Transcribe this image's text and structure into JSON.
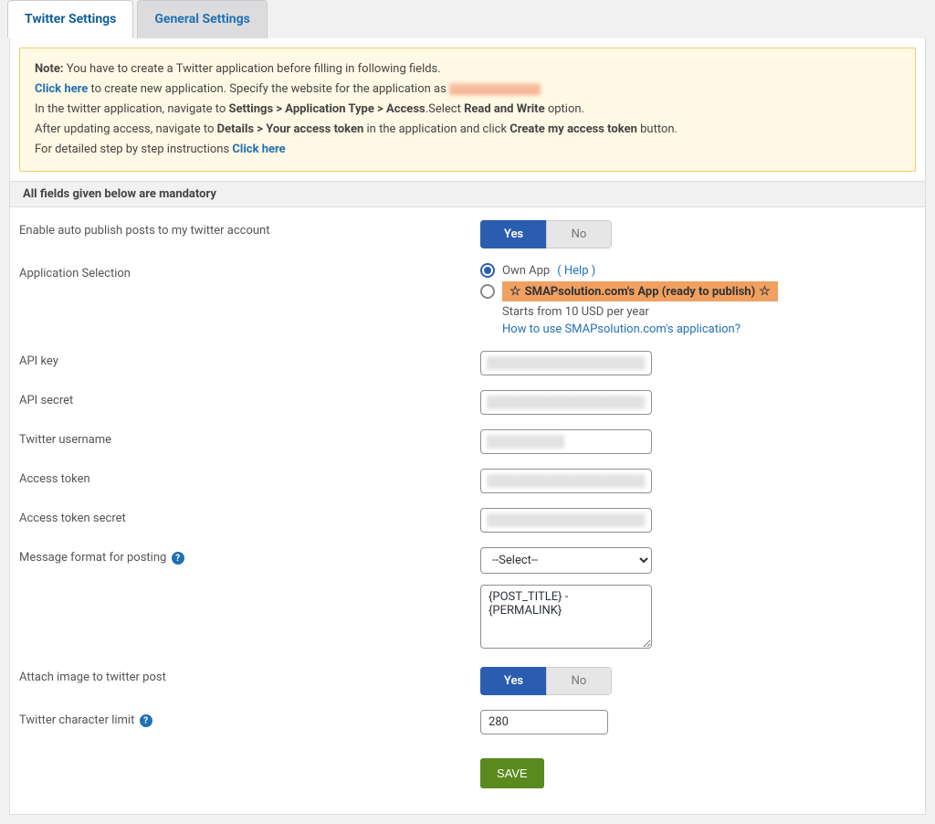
{
  "tabs": {
    "twitter": "Twitter Settings",
    "general": "General Settings"
  },
  "notice": {
    "note_label": "Note:",
    "note_text": " You have to create a Twitter application before filling in following fields.",
    "click_here1": "Click here",
    "line2_a": " to create new application. Specify the website for the application as ",
    "line3_a": "In the twitter application, navigate to ",
    "line3_b": "Settings > Application Type > Access",
    "line3_c": ".Select ",
    "line3_d": "Read and Write",
    "line3_e": " option.",
    "line4_a": "After updating access, navigate to ",
    "line4_b": "Details > Your access token",
    "line4_c": " in the application and click ",
    "line4_d": "Create my access token",
    "line4_e": " button.",
    "line5_a": "For detailed step by step instructions ",
    "click_here2": "Click here"
  },
  "section_header": "All fields given below are mandatory",
  "labels": {
    "enable_auto": "Enable auto publish posts to my twitter account",
    "app_selection": "Application Selection",
    "api_key": "API key",
    "api_secret": "API secret",
    "twitter_username": "Twitter username",
    "access_token": "Access token",
    "access_token_secret": "Access token secret",
    "message_format": "Message format for posting",
    "attach_image": "Attach image to twitter post",
    "char_limit": "Twitter character limit"
  },
  "toggle": {
    "yes": "Yes",
    "no": "No"
  },
  "app_options": {
    "own_app": "Own App",
    "help": "( Help )",
    "smap_label": "SMAPsolution.com's App (ready to publish)",
    "starts_from": "Starts from 10 USD per year",
    "how_to": "How to use SMAPsolution.com's application?"
  },
  "select_placeholder": "--Select--",
  "message_format_value": "{POST_TITLE} - {PERMALINK}",
  "char_limit_value": "280",
  "save": "SAVE"
}
